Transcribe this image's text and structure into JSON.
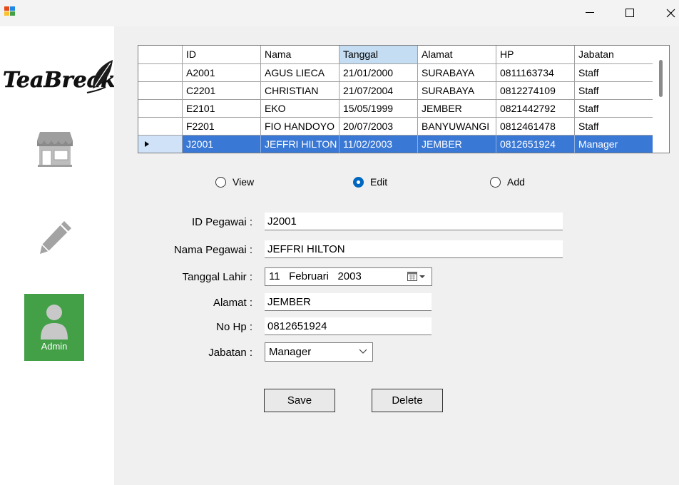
{
  "window": {
    "minimize_glyph": "–",
    "maximize_glyph": "□",
    "close_glyph": "✕"
  },
  "sidebar": {
    "logo_text": "TeaBreak",
    "admin_label": "Admin"
  },
  "grid": {
    "columns": [
      "ID",
      "Nama",
      "Tanggal",
      "Alamat",
      "HP",
      "Jabatan"
    ],
    "sorted_column": "Tanggal",
    "rows": [
      [
        "A2001",
        "AGUS LIECA",
        "21/01/2000",
        "SURABAYA",
        "0811163734",
        "Staff"
      ],
      [
        "C2201",
        "CHRISTIAN",
        "21/07/2004",
        "SURABAYA",
        "0812274109",
        "Staff"
      ],
      [
        "E2101",
        "EKO",
        "15/05/1999",
        "JEMBER",
        "0821442792",
        "Staff"
      ],
      [
        "F2201",
        "FIO HANDOYO",
        "20/07/2003",
        "BANYUWANGI",
        "0812461478",
        "Staff"
      ],
      [
        "J2001",
        "JEFFRI HILTON",
        "11/02/2003",
        "JEMBER",
        "0812651924",
        "Manager"
      ]
    ],
    "selected_row": 4
  },
  "mode": {
    "view": "View",
    "edit": "Edit",
    "add": "Add",
    "selected": "edit"
  },
  "form": {
    "id_label": "ID Pegawai :",
    "id_value": "J2001",
    "nama_label": "Nama Pegawai :",
    "nama_value": "JEFFRI HILTON",
    "tgl_label": "Tanggal Lahir :",
    "tgl_day": "11",
    "tgl_month": "Februari",
    "tgl_year": "2003",
    "alamat_label": "Alamat :",
    "alamat_value": "JEMBER",
    "hp_label": "No Hp :",
    "hp_value": "0812651924",
    "jabatan_label": "Jabatan :",
    "jabatan_value": "Manager"
  },
  "buttons": {
    "save": "Save",
    "delete": "Delete"
  },
  "colors": {
    "selection": "#3a78d6",
    "admin_bg": "#43a047",
    "radio_accent": "#0067c0"
  }
}
